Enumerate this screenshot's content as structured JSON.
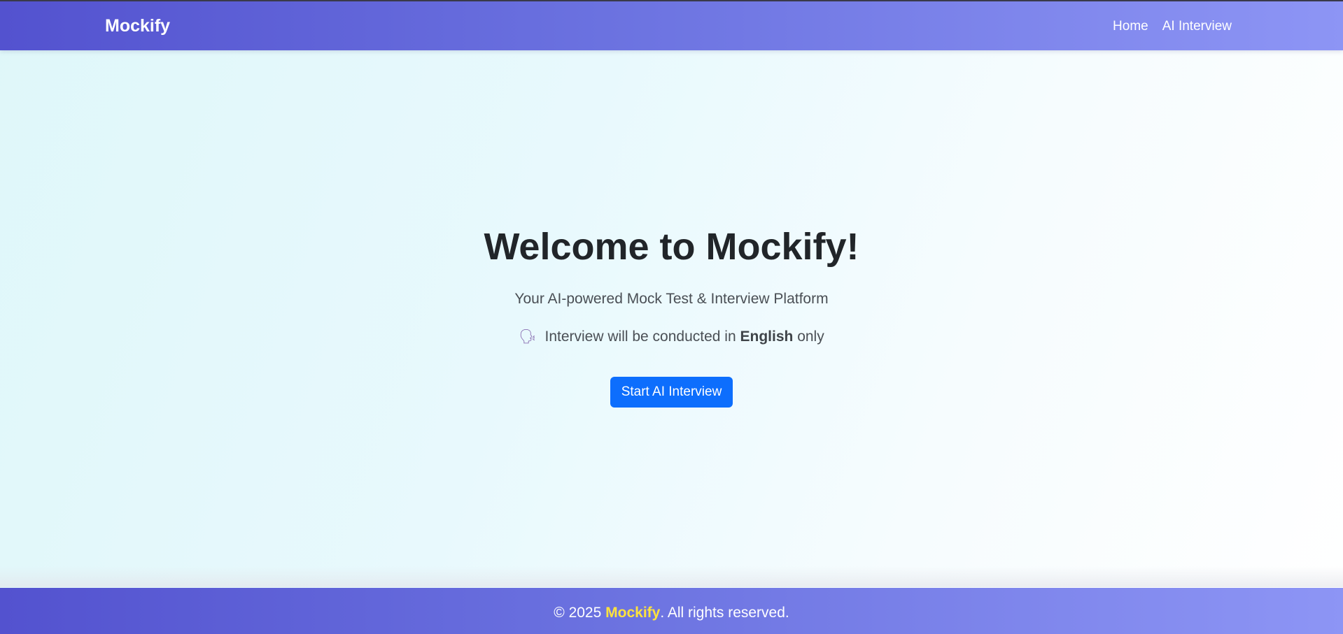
{
  "navbar": {
    "brand": "Mockify",
    "links": [
      {
        "label": "Home"
      },
      {
        "label": "AI Interview"
      }
    ]
  },
  "hero": {
    "title": "Welcome to Mockify!",
    "subtitle": "Your AI-powered Mock Test & Interview Platform",
    "note": {
      "icon": "speaking-head-icon",
      "prefix": "Interview will be conducted in",
      "language": "English",
      "suffix": "only"
    },
    "cta_label": "Start AI Interview"
  },
  "footer": {
    "copyright": "© 2025",
    "brand": "Mockify",
    "rights": ". All rights reserved."
  },
  "colors": {
    "nav_gradient_start": "#5352cf",
    "nav_gradient_end": "#8d95f5",
    "cta": "#0d6efd",
    "footer_brand": "#ffe33d"
  }
}
